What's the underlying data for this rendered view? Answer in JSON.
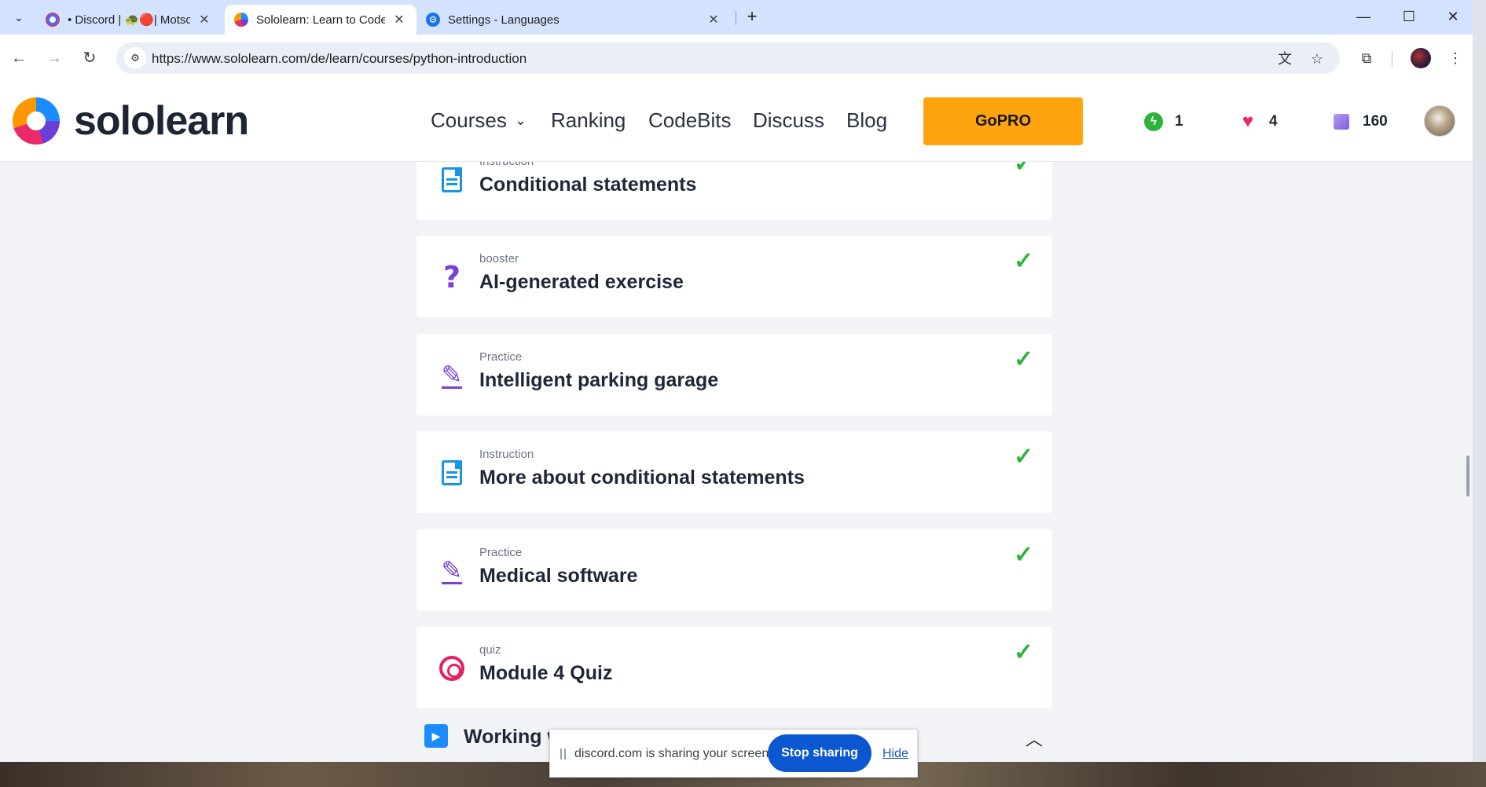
{
  "browser": {
    "tabs": [
      {
        "title": "• Discord | 🐢🔴| Motsone",
        "active": false
      },
      {
        "title": "Sololearn: Learn to Code",
        "active": true
      },
      {
        "title": "Settings - Languages",
        "active": false
      }
    ],
    "new_tab_label": "+",
    "url": "https://www.sololearn.com/de/learn/courses/python-introduction"
  },
  "header": {
    "brand": "sololearn",
    "nav": {
      "courses": "Courses",
      "ranking": "Ranking",
      "codebits": "CodeBits",
      "discuss": "Discuss",
      "blog": "Blog"
    },
    "gopro": "GoPRO",
    "streak": "1",
    "hearts": "4",
    "gems": "160"
  },
  "lessons": [
    {
      "type": "Instruction",
      "title": "Conditional statements",
      "icon": "instruction-icon",
      "completed": true
    },
    {
      "type": "booster",
      "title": "AI-generated exercise",
      "icon": "question-icon",
      "completed": true
    },
    {
      "type": "Practice",
      "title": "Intelligent parking garage",
      "icon": "practice-pen-icon",
      "completed": true
    },
    {
      "type": "Instruction",
      "title": "More about conditional statements",
      "icon": "instruction-icon",
      "completed": true
    },
    {
      "type": "Practice",
      "title": "Medical software",
      "icon": "practice-pen-icon",
      "completed": true
    },
    {
      "type": "quiz",
      "title": "Module 4 Quiz",
      "icon": "target-icon",
      "completed": true
    }
  ],
  "next_module": {
    "title": "Working w"
  },
  "share_bar": {
    "message": "discord.com is sharing your screen.",
    "stop": "Stop sharing",
    "hide": "Hide"
  },
  "colors": {
    "accent_gold": "#ffa40e",
    "check_green": "#2bb43a",
    "share_blue": "#0b57d0"
  }
}
